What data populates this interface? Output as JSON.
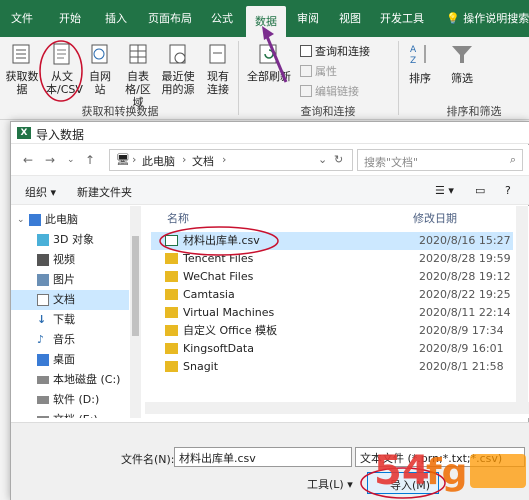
{
  "ribbon": {
    "tabs": [
      "文件",
      "开始",
      "插入",
      "页面布局",
      "公式",
      "数据",
      "审阅",
      "视图",
      "开发工具"
    ],
    "active_tab": "数据",
    "tell_me": "操作说明搜索",
    "get_transform": {
      "get_data": "获取数据",
      "from_text": "从文本/CSV",
      "from_web": "自网站",
      "from_table": "自表格/区域",
      "recent_sources": "最近使用的源",
      "existing": "现有连接",
      "label": "获取和转换数据"
    },
    "queries": {
      "refresh_all": "全部刷新",
      "queries_connections": "查询和连接",
      "properties": "属性",
      "edit_links": "编辑链接",
      "label": "查询和连接"
    },
    "sort_filter": {
      "sort": "排序",
      "filter": "筛选",
      "label": "排序和筛选"
    }
  },
  "dialog": {
    "title": "导入数据",
    "breadcrumb": [
      "此电脑",
      "文档"
    ],
    "search_placeholder": "搜索\"文档\"",
    "organize": "组织",
    "new_folder": "新建文件夹",
    "nav_items": [
      {
        "label": "此电脑",
        "icon": "computer-icon"
      },
      {
        "label": "3D 对象",
        "icon": "cube-icon"
      },
      {
        "label": "视频",
        "icon": "video-icon"
      },
      {
        "label": "图片",
        "icon": "picture-icon"
      },
      {
        "label": "文档",
        "icon": "document-icon"
      },
      {
        "label": "下载",
        "icon": "download-icon"
      },
      {
        "label": "音乐",
        "icon": "music-icon"
      },
      {
        "label": "桌面",
        "icon": "desktop-icon"
      },
      {
        "label": "本地磁盘 (C:)",
        "icon": "drive-icon"
      },
      {
        "label": "软件 (D:)",
        "icon": "drive-icon"
      },
      {
        "label": "文档 (E:)",
        "icon": "drive-icon"
      }
    ],
    "columns": {
      "name": "名称",
      "modified": "修改日期"
    },
    "files": [
      {
        "name": "材料出库单.csv",
        "date": "2020/8/16 15:27",
        "type": "csv"
      },
      {
        "name": "Tencent Files",
        "date": "2020/8/28 19:59",
        "type": "folder"
      },
      {
        "name": "WeChat Files",
        "date": "2020/8/28 19:12",
        "type": "folder"
      },
      {
        "name": "Camtasia",
        "date": "2020/8/22 19:25",
        "type": "folder"
      },
      {
        "name": "Virtual Machines",
        "date": "2020/8/11 22:14",
        "type": "folder"
      },
      {
        "name": "自定义 Office 模板",
        "date": "2020/8/9 17:34",
        "type": "folder"
      },
      {
        "name": "KingsoftData",
        "date": "2020/8/9 16:01",
        "type": "folder"
      },
      {
        "name": "Snagit",
        "date": "2020/8/1 21:58",
        "type": "folder"
      }
    ],
    "filename_label": "文件名(N):",
    "filename_value": "材料出库单.csv",
    "filetype_value": "文本文件 (*.prn;*.txt;*.csv)",
    "tools_label": "工具(L)",
    "open_label": "导入(M)"
  },
  "colors": {
    "excel_green": "#217346",
    "selection": "#cce8ff",
    "annotation_red": "#c8102e",
    "annotation_purple": "#7b2d8e"
  }
}
